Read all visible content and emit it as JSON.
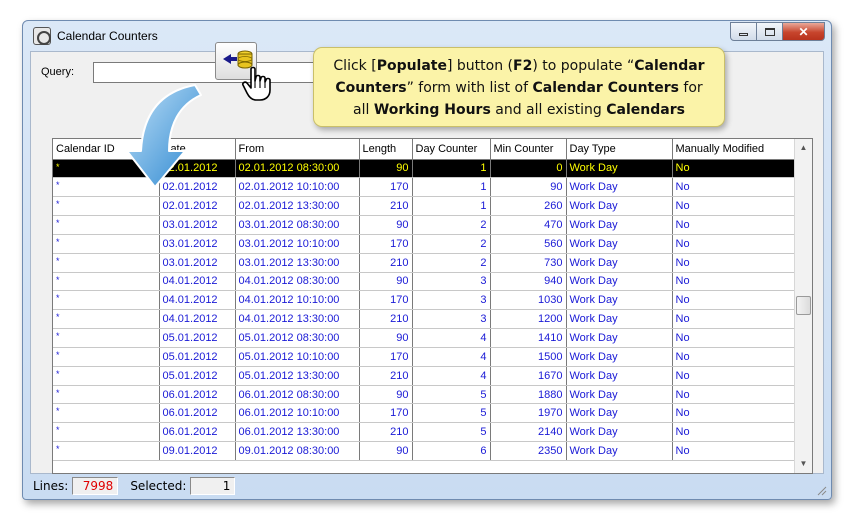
{
  "window": {
    "title": "Calendar Counters"
  },
  "query": {
    "label": "Query:",
    "value": ""
  },
  "tooltip": {
    "line1": [
      "Click [",
      "Populate",
      "] button (",
      "F2",
      ") to populate “",
      "Calendar"
    ],
    "line2": [
      "Counters",
      "” form with list of ",
      "Calendar Counters",
      " for"
    ],
    "line3": [
      "all ",
      "Working Hours",
      " and all existing ",
      "Calendars"
    ]
  },
  "grid": {
    "columns": [
      "Calendar ID",
      "Date",
      "From",
      "Length",
      "Day Counter",
      "Min Counter",
      "Day Type",
      "Manually Modified"
    ],
    "rows": [
      [
        "*",
        "02.01.2012",
        "02.01.2012 08:30:00",
        "90",
        "1",
        "0",
        "Work Day",
        "No"
      ],
      [
        "*",
        "02.01.2012",
        "02.01.2012 10:10:00",
        "170",
        "1",
        "90",
        "Work Day",
        "No"
      ],
      [
        "*",
        "02.01.2012",
        "02.01.2012 13:30:00",
        "210",
        "1",
        "260",
        "Work Day",
        "No"
      ],
      [
        "*",
        "03.01.2012",
        "03.01.2012 08:30:00",
        "90",
        "2",
        "470",
        "Work Day",
        "No"
      ],
      [
        "*",
        "03.01.2012",
        "03.01.2012 10:10:00",
        "170",
        "2",
        "560",
        "Work Day",
        "No"
      ],
      [
        "*",
        "03.01.2012",
        "03.01.2012 13:30:00",
        "210",
        "2",
        "730",
        "Work Day",
        "No"
      ],
      [
        "*",
        "04.01.2012",
        "04.01.2012 08:30:00",
        "90",
        "3",
        "940",
        "Work Day",
        "No"
      ],
      [
        "*",
        "04.01.2012",
        "04.01.2012 10:10:00",
        "170",
        "3",
        "1030",
        "Work Day",
        "No"
      ],
      [
        "*",
        "04.01.2012",
        "04.01.2012 13:30:00",
        "210",
        "3",
        "1200",
        "Work Day",
        "No"
      ],
      [
        "*",
        "05.01.2012",
        "05.01.2012 08:30:00",
        "90",
        "4",
        "1410",
        "Work Day",
        "No"
      ],
      [
        "*",
        "05.01.2012",
        "05.01.2012 10:10:00",
        "170",
        "4",
        "1500",
        "Work Day",
        "No"
      ],
      [
        "*",
        "05.01.2012",
        "05.01.2012 13:30:00",
        "210",
        "4",
        "1670",
        "Work Day",
        "No"
      ],
      [
        "*",
        "06.01.2012",
        "06.01.2012 08:30:00",
        "90",
        "5",
        "1880",
        "Work Day",
        "No"
      ],
      [
        "*",
        "06.01.2012",
        "06.01.2012 10:10:00",
        "170",
        "5",
        "1970",
        "Work Day",
        "No"
      ],
      [
        "*",
        "06.01.2012",
        "06.01.2012 13:30:00",
        "210",
        "5",
        "2140",
        "Work Day",
        "No"
      ],
      [
        "*",
        "09.01.2012",
        "09.01.2012 08:30:00",
        "90",
        "6",
        "2350",
        "Work Day",
        "No"
      ]
    ],
    "selected_row": 0
  },
  "status": {
    "lines_label": "Lines:",
    "lines_value": "7998",
    "selected_label": "Selected:",
    "selected_value": "1"
  },
  "colors": {
    "cell_text": "#1a1ad6",
    "selected_bg": "#000000",
    "selected_text": "#ffff00",
    "tooltip_bg": "#fbf3a8",
    "lines_value": "#e00000"
  }
}
